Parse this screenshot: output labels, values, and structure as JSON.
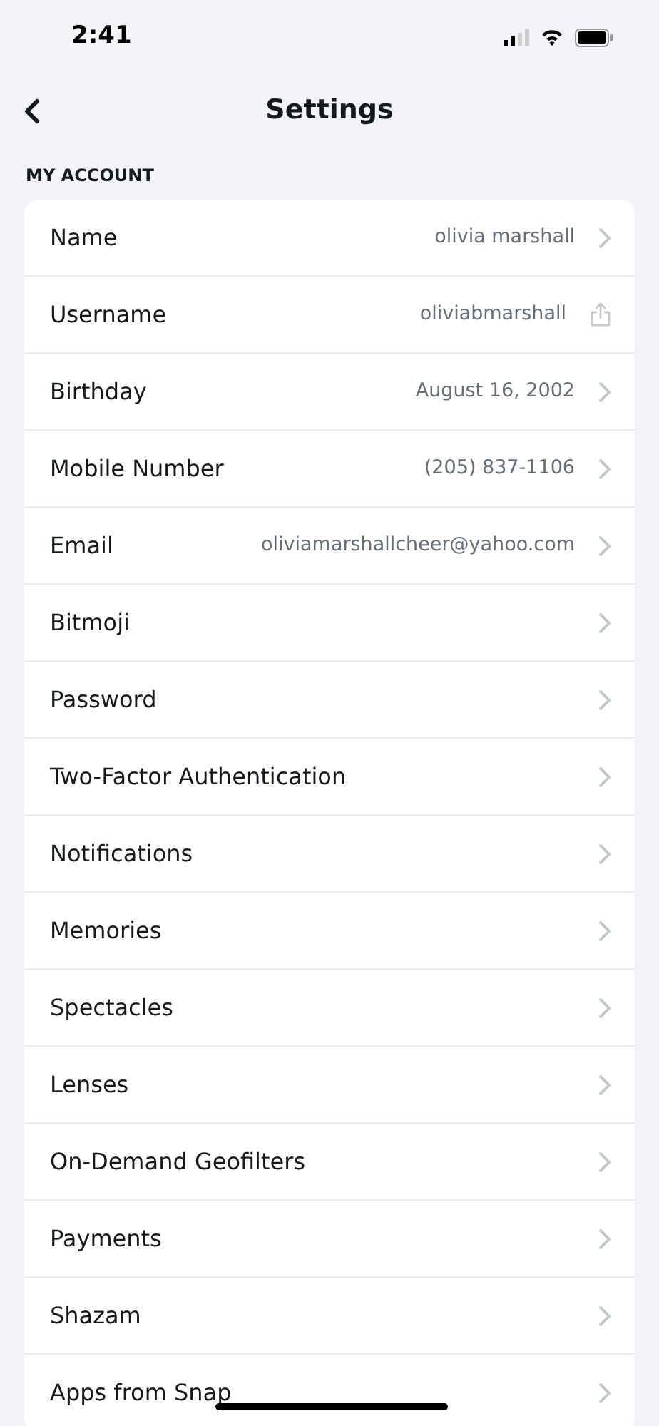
{
  "status_bar": {
    "time": "2:41"
  },
  "header": {
    "title": "Settings"
  },
  "section": {
    "title": "MY ACCOUNT"
  },
  "rows": [
    {
      "label": "Name",
      "value": "olivia marshall",
      "kind": "chevron"
    },
    {
      "label": "Username",
      "value": "oliviabmarshall",
      "kind": "share"
    },
    {
      "label": "Birthday",
      "value": "August 16, 2002",
      "kind": "chevron"
    },
    {
      "label": "Mobile Number",
      "value": "(205) 837-1106",
      "kind": "chevron"
    },
    {
      "label": "Email",
      "value": "oliviamarshallcheer@yahoo.com",
      "kind": "chevron"
    },
    {
      "label": "Bitmoji",
      "kind": "chevron"
    },
    {
      "label": "Password",
      "kind": "chevron"
    },
    {
      "label": "Two-Factor Authentication",
      "kind": "chevron"
    },
    {
      "label": "Notifications",
      "kind": "chevron"
    },
    {
      "label": "Memories",
      "kind": "chevron"
    },
    {
      "label": "Spectacles",
      "kind": "chevron"
    },
    {
      "label": "Lenses",
      "kind": "chevron"
    },
    {
      "label": "On-Demand Geofilters",
      "kind": "chevron"
    },
    {
      "label": "Payments",
      "kind": "chevron"
    },
    {
      "label": "Shazam",
      "kind": "chevron"
    },
    {
      "label": "Apps from Snap",
      "kind": "chevron"
    }
  ]
}
